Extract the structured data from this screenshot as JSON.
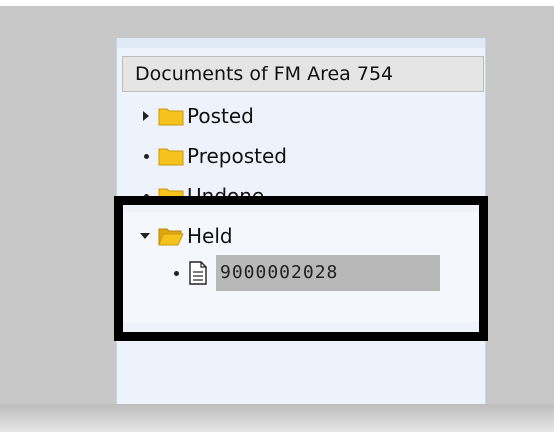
{
  "tree": {
    "header": "Documents of FM Area 754",
    "nodes": [
      {
        "label": "Posted",
        "expander": "collapsed"
      },
      {
        "label": "Preposted",
        "expander": "leaf"
      },
      {
        "label": "Undone",
        "expander": "leaf"
      }
    ],
    "held": {
      "label": "Held",
      "expander": "expanded",
      "document": "9000002028"
    }
  },
  "icons": {
    "folder": "folder-icon",
    "open_folder": "open-folder-icon",
    "document": "document-icon"
  },
  "colors": {
    "folder": "#f6c21c",
    "highlight_border": "#000000",
    "selection": "#b8b8b8"
  }
}
